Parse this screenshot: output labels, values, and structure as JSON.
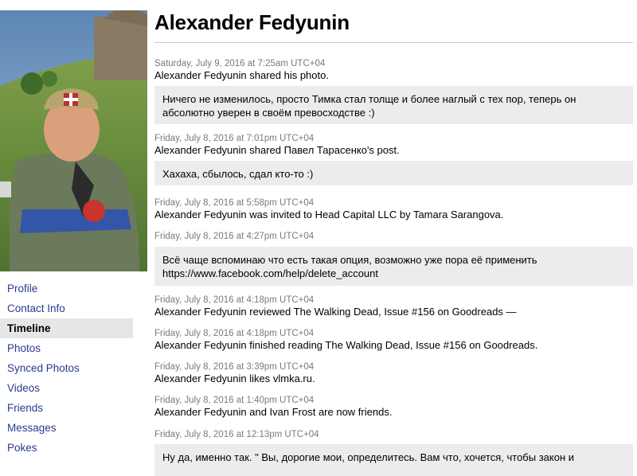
{
  "sidebar": {
    "nav": [
      {
        "label": "Profile"
      },
      {
        "label": "Contact Info"
      },
      {
        "label": "Timeline"
      },
      {
        "label": "Photos"
      },
      {
        "label": "Synced Photos"
      },
      {
        "label": "Videos"
      },
      {
        "label": "Friends"
      },
      {
        "label": "Messages"
      },
      {
        "label": "Pokes"
      }
    ],
    "active": "Timeline"
  },
  "main": {
    "title": "Alexander Fedyunin",
    "entries": [
      {
        "meta": "Saturday, July 9, 2016 at 7:25am UTC+04",
        "text": "Alexander Fedyunin shared his photo.",
        "comment": "Ничего не изменилось, просто Тимка стал толще и более наглый с тех пор, теперь он абсолютно уверен в своём превосходстве :)"
      },
      {
        "meta": "Friday, July 8, 2016 at 7:01pm UTC+04",
        "text": "Alexander Fedyunin shared Павел Тарасенко's post.",
        "comment": "Хахаха, сбылось, сдал кто-то :)"
      },
      {
        "meta": "Friday, July 8, 2016 at 5:58pm UTC+04",
        "text": "Alexander Fedyunin was invited to Head Capital LLC by Tamara Sarangova."
      },
      {
        "meta": "Friday, July 8, 2016 at 4:27pm UTC+04",
        "comment": "Всё чаще вспоминаю что есть такая опция, возможно уже пора её применить https://www.facebook.com/help/delete_account"
      },
      {
        "meta": "Friday, July 8, 2016 at 4:18pm UTC+04",
        "text": "Alexander Fedyunin reviewed The Walking Dead, Issue #156 on Goodreads —"
      },
      {
        "meta": "Friday, July 8, 2016 at 4:18pm UTC+04",
        "text": "Alexander Fedyunin finished reading The Walking Dead, Issue #156 on Goodreads."
      },
      {
        "meta": "Friday, July 8, 2016 at 3:39pm UTC+04",
        "text": "Alexander Fedyunin likes vlmka.ru."
      },
      {
        "meta": "Friday, July 8, 2016 at 1:40pm UTC+04",
        "text": "Alexander Fedyunin and Ivan Frost are now friends."
      },
      {
        "meta": "Friday, July 8, 2016 at 12:13pm UTC+04",
        "comment": "Ну да, именно так. \" Вы, дорогие мои, определитесь. Вам что, хочется, чтобы закон и"
      }
    ]
  }
}
